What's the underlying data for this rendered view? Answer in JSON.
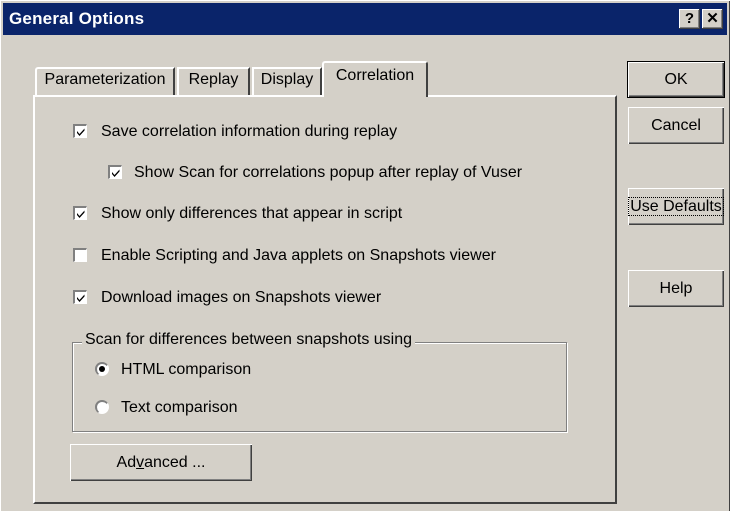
{
  "window": {
    "title": "General Options"
  },
  "titlebar_buttons": {
    "help_label": "?",
    "close_label": "✕"
  },
  "tabs": [
    {
      "label": "Parameterization",
      "active": false
    },
    {
      "label": "Replay",
      "active": false
    },
    {
      "label": "Display",
      "active": false
    },
    {
      "label": "Correlation",
      "active": true
    }
  ],
  "options": {
    "save_correlation": {
      "label": "Save correlation information during replay",
      "checked": true
    },
    "show_scan_popup": {
      "label": "Show Scan for correlations popup after replay of Vuser",
      "checked": true
    },
    "show_only_differences": {
      "label": "Show only differences that appear in script",
      "checked": true
    },
    "enable_scripting": {
      "label": "Enable Scripting and Java applets on Snapshots viewer",
      "checked": false
    },
    "download_images": {
      "label": "Download images on Snapshots viewer",
      "checked": true
    }
  },
  "scan_group": {
    "label": "Scan for differences between snapshots using",
    "options": [
      {
        "label": "HTML comparison",
        "selected": true
      },
      {
        "label": "Text comparison",
        "selected": false
      }
    ]
  },
  "advanced_button": {
    "prefix": "Ad",
    "mnemonic": "v",
    "suffix": "anced ..."
  },
  "side_buttons": {
    "ok": "OK",
    "cancel": "Cancel",
    "use_defaults": "Use Defaults",
    "help": "Help"
  }
}
